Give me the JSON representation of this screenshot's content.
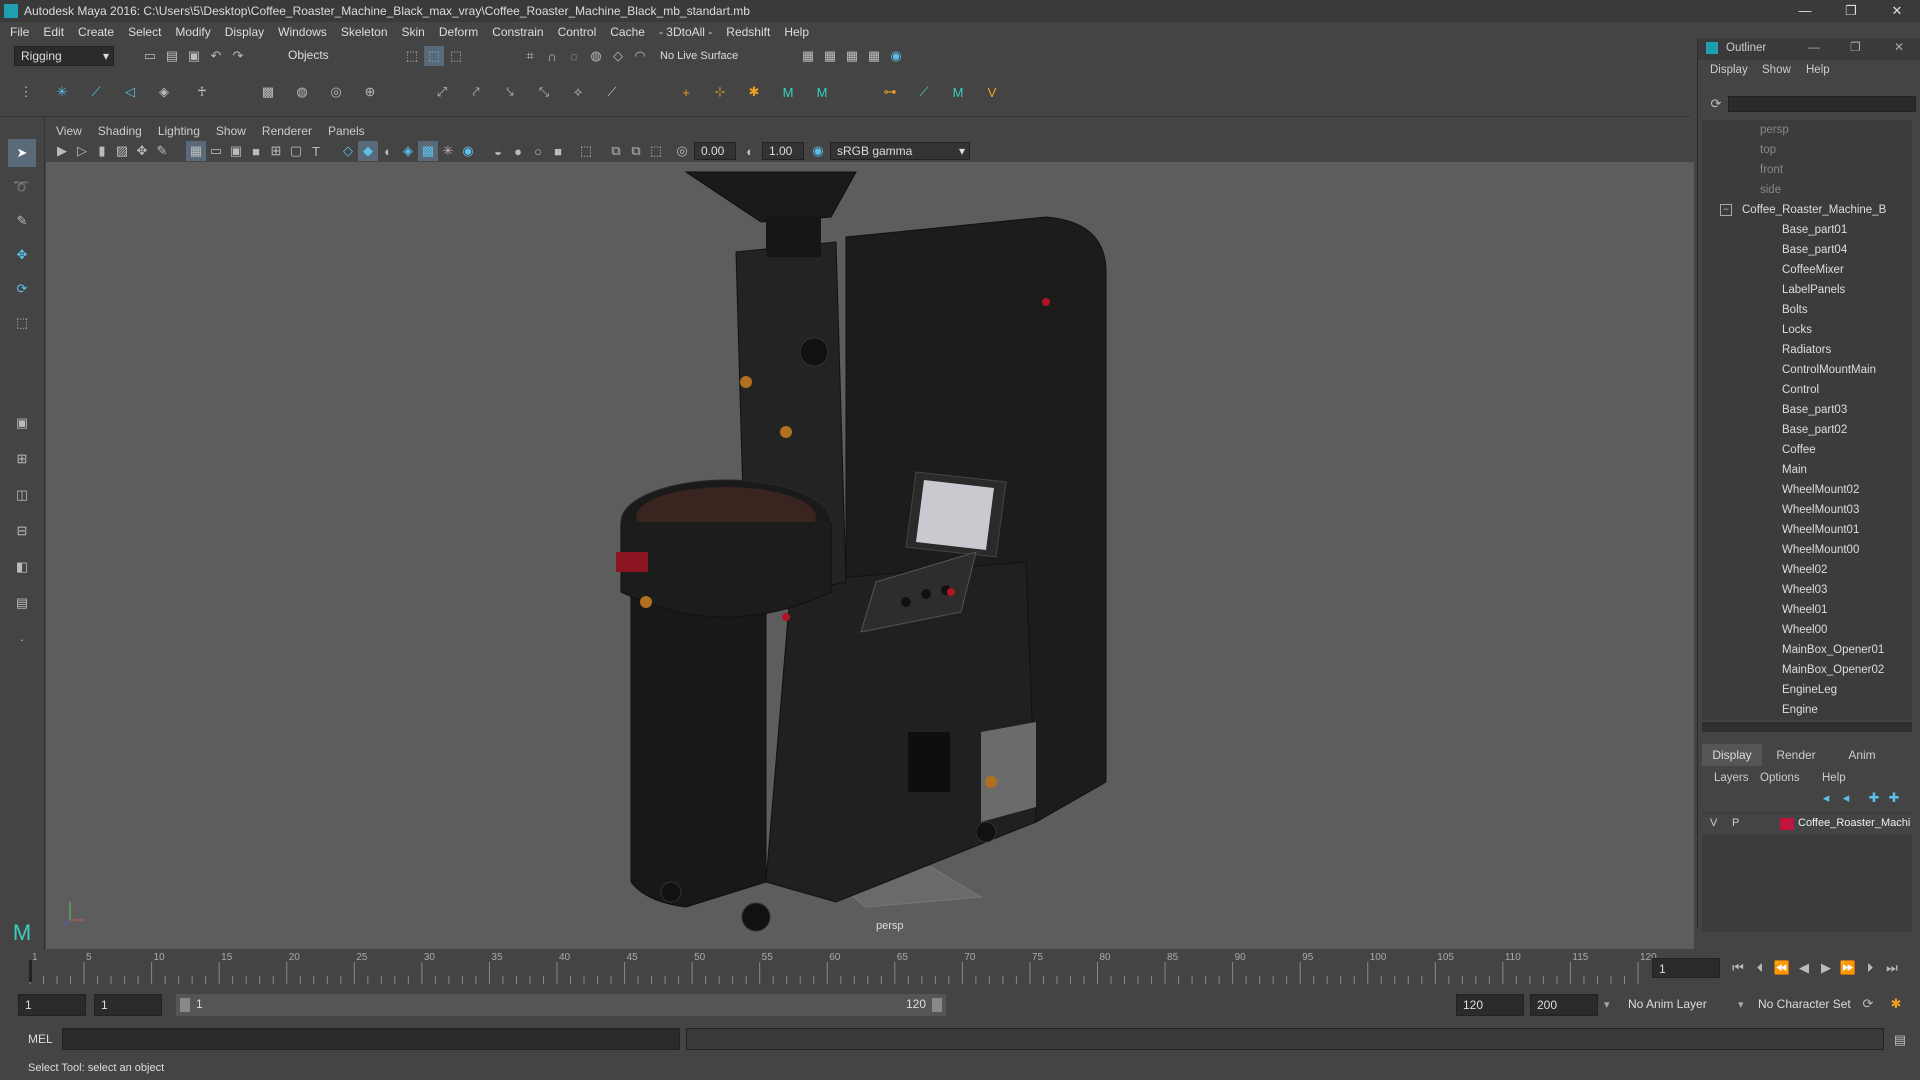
{
  "window": {
    "title": "Autodesk Maya 2016: C:\\Users\\5\\Desktop\\Coffee_Roaster_Machine_Black_max_vray\\Coffee_Roaster_Machine_Black_mb_standart.mb",
    "minimize": "—",
    "restore": "❐",
    "close": "✕"
  },
  "menu": [
    "File",
    "Edit",
    "Create",
    "Select",
    "Modify",
    "Display",
    "Windows",
    "Skeleton",
    "Skin",
    "Deform",
    "Constrain",
    "Control",
    "Cache",
    "- 3DtoAll -",
    "Redshift",
    "Help"
  ],
  "statusline": {
    "mode": "Rigging",
    "objects": "Objects",
    "live_surface": "No Live Surface"
  },
  "panel": {
    "menu": [
      "View",
      "Shading",
      "Lighting",
      "Show",
      "Renderer",
      "Panels"
    ],
    "exposure": "0.00",
    "gamma": "1.00",
    "color_space": "sRGB gamma",
    "camera_label": "persp"
  },
  "outliner": {
    "title": "Outliner",
    "menu": [
      "Display",
      "Show",
      "Help"
    ],
    "cameras": [
      "persp",
      "top",
      "front",
      "side"
    ],
    "root": "Coffee_Roaster_Machine_B",
    "children": [
      "Base_part01",
      "Base_part04",
      "CoffeeMixer",
      "LabelPanels",
      "Bolts",
      "Locks",
      "Radiators",
      "ControlMountMain",
      "Control",
      "Base_part03",
      "Base_part02",
      "Coffee",
      "Main",
      "WheelMount02",
      "WheelMount03",
      "WheelMount01",
      "WheelMount00",
      "Wheel02",
      "Wheel03",
      "Wheel01",
      "Wheel00",
      "MainBox_Opener01",
      "MainBox_Opener02",
      "EngineLeg",
      "Engine"
    ]
  },
  "layers": {
    "tabs": [
      "Display",
      "Render",
      "Anim"
    ],
    "menu": [
      "Layers",
      "Options",
      "Help"
    ],
    "layer": {
      "v": "V",
      "p": "P",
      "name": "Coffee_Roaster_Machi",
      "color": "#c0143c"
    }
  },
  "timeline": {
    "ticks": [
      "1",
      "5",
      "10",
      "15",
      "20",
      "25",
      "30",
      "35",
      "40",
      "45",
      "50",
      "55",
      "60",
      "65",
      "70",
      "75",
      "80",
      "85",
      "90",
      "95",
      "100",
      "105",
      "110",
      "115",
      "120"
    ],
    "current_frame": "1"
  },
  "range": {
    "start": "1",
    "playback_start": "1",
    "slider_start": "1",
    "slider_end": "120",
    "playback_end": "120",
    "end": "200",
    "anim_layer": "No Anim Layer",
    "char_set": "No Character Set"
  },
  "cmd": {
    "label": "MEL"
  },
  "help": {
    "text": "Select Tool: select an object"
  }
}
